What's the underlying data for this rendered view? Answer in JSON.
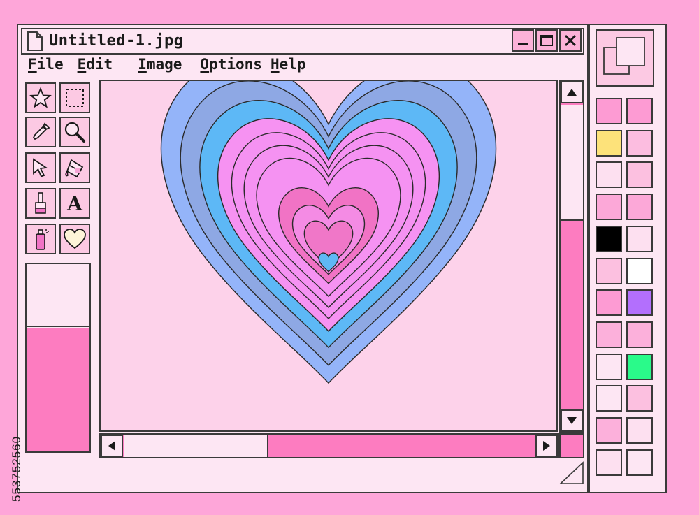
{
  "window": {
    "title": "Untitled-1.jpg",
    "controls": [
      "minimize-icon",
      "maximize-icon",
      "close-icon"
    ]
  },
  "menu": [
    {
      "label": "File",
      "key": "F",
      "rest": "ile"
    },
    {
      "label": "Edit",
      "key": "E",
      "rest": "dit"
    },
    {
      "label": "Image",
      "key": "I",
      "rest": "mage"
    },
    {
      "label": "Options",
      "key": "O",
      "rest": "ptions"
    },
    {
      "label": "Help",
      "key": "H",
      "rest": "elp"
    }
  ],
  "tools": [
    "star-icon",
    "rect-select-icon",
    "eyedropper-icon",
    "magnifier-icon",
    "pointer-icon",
    "paint-bucket-icon",
    "brush-icon",
    "text-icon",
    "spray-can-icon",
    "heart-icon"
  ],
  "tool_text_glyph": "A",
  "colors": {
    "primary": "#fde6f3",
    "secondary": "#fd7cc0"
  },
  "palette": [
    "#fd9bd3",
    "#fd9bd3",
    "#fde27a",
    "#fcbde0",
    "#fde0f0",
    "#fcc0e0",
    "#fca8d8",
    "#fca8d8",
    "#000000",
    "#fde0f0",
    "#fcc0e0",
    "#ffffff",
    "#fd9bd3",
    "#b36ffd",
    "#fcb0db",
    "#fcb0db",
    "#fde6f3",
    "#2afa8a",
    "#fde6f3",
    "#fcc0e0",
    "#fcb0db",
    "#fde0f0",
    "#fde0f0",
    "#fde6f3"
  ],
  "heart_layers": [
    "#94b4f9",
    "#8ea8e4",
    "#5db8f6",
    "#f692f2",
    "#f592f2",
    "#f592f2",
    "#f592f2",
    "#f173c5",
    "#f48be4",
    "#f077c8",
    "#5fb8f5"
  ],
  "scroll": {
    "vertical_position": 0.38,
    "horizontal_position": 0.35
  },
  "watermark": "553752560"
}
